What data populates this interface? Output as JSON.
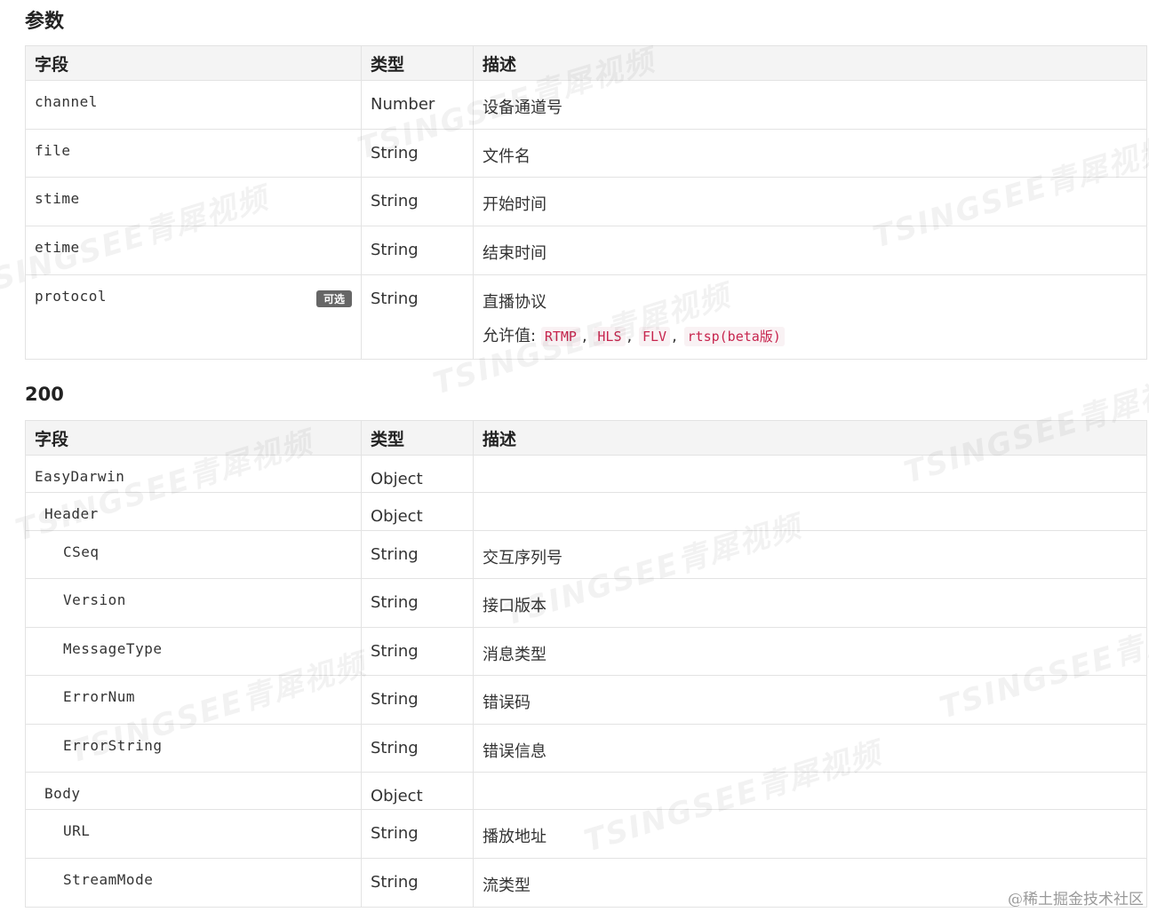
{
  "sections": {
    "params_title": "参数",
    "response_title": "200"
  },
  "headers": {
    "field": "字段",
    "type": "类型",
    "desc": "描述"
  },
  "params": [
    {
      "name": "channel",
      "type": "Number",
      "desc": "设备通道号"
    },
    {
      "name": "file",
      "type": "String",
      "desc": "文件名"
    },
    {
      "name": "stime",
      "type": "String",
      "desc": "开始时间"
    },
    {
      "name": "etime",
      "type": "String",
      "desc": "结束时间"
    },
    {
      "name": "protocol",
      "tag": "可选",
      "type": "String",
      "desc": "直播协议",
      "allowed_label": "允许值:",
      "allowed_values": [
        "RTMP",
        "HLS",
        "FLV",
        "rtsp(beta版)"
      ]
    }
  ],
  "response": [
    {
      "name": "EasyDarwin",
      "type": "Object",
      "desc": ""
    },
    {
      "name": "Header",
      "type": "Object",
      "desc": ""
    },
    {
      "name": "CSeq",
      "type": "String",
      "desc": "交互序列号"
    },
    {
      "name": "Version",
      "type": "String",
      "desc": "接口版本"
    },
    {
      "name": "MessageType",
      "type": "String",
      "desc": "消息类型"
    },
    {
      "name": "ErrorNum",
      "type": "String",
      "desc": "错误码"
    },
    {
      "name": "ErrorString",
      "type": "String",
      "desc": "错误信息"
    },
    {
      "name": "Body",
      "type": "Object",
      "desc": ""
    },
    {
      "name": "URL",
      "type": "String",
      "desc": "播放地址"
    },
    {
      "name": "StreamMode",
      "type": "String",
      "desc": "流类型"
    }
  ],
  "watermark_text": "TSINGSEE青犀视频",
  "footer": "@稀土掘金技术社区"
}
